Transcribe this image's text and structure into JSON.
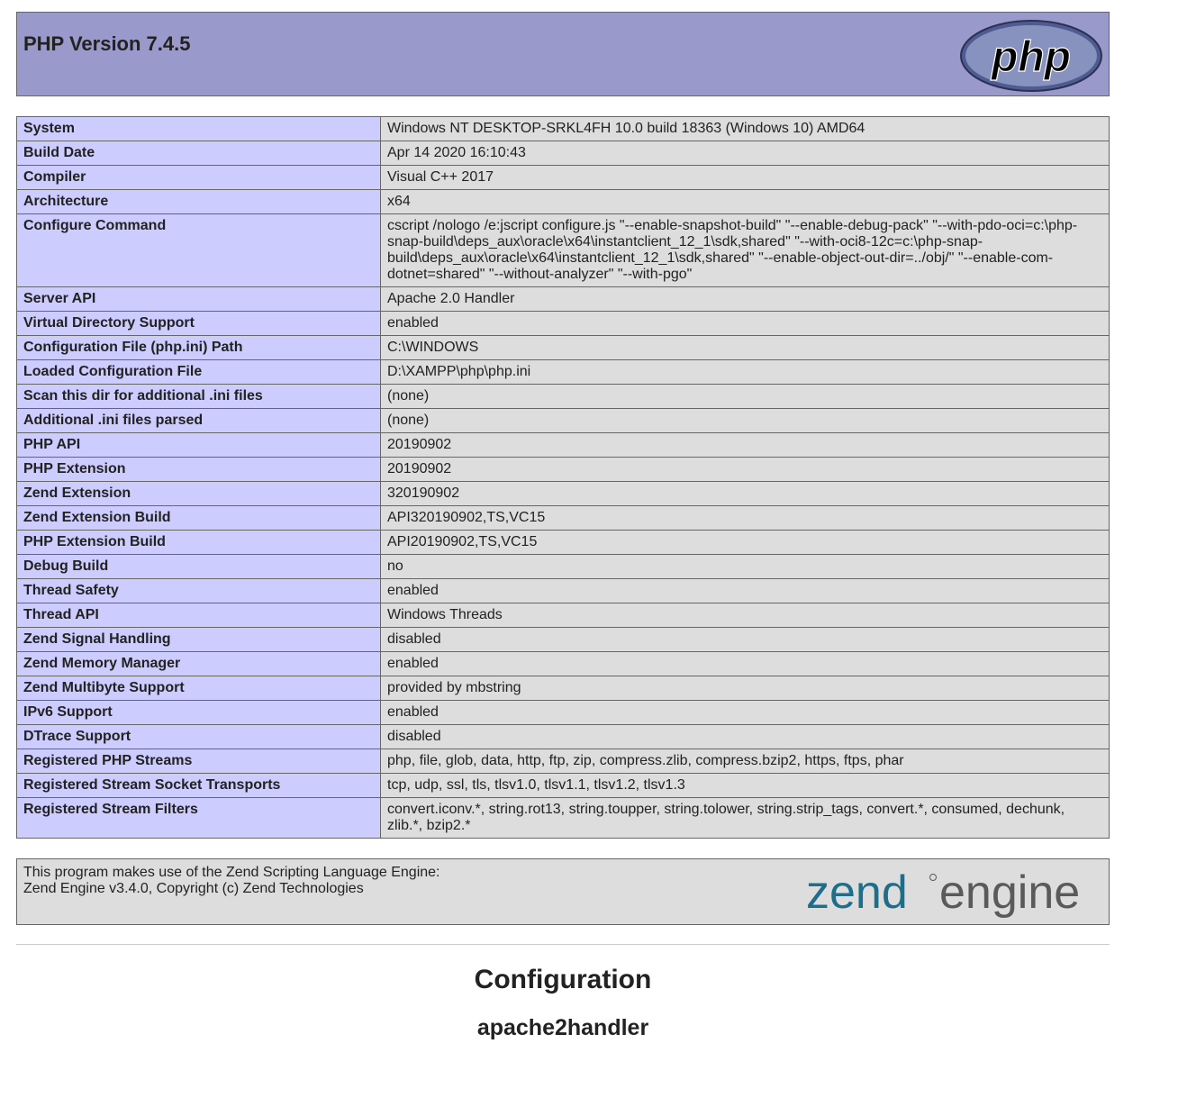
{
  "header": {
    "title": "PHP Version 7.4.5",
    "logo_text": "php"
  },
  "info_rows": [
    {
      "key": "System",
      "value": "Windows NT DESKTOP-SRKL4FH 10.0 build 18363 (Windows 10) AMD64"
    },
    {
      "key": "Build Date",
      "value": "Apr 14 2020 16:10:43"
    },
    {
      "key": "Compiler",
      "value": "Visual C++ 2017"
    },
    {
      "key": "Architecture",
      "value": "x64"
    },
    {
      "key": "Configure Command",
      "value": "cscript /nologo /e:jscript configure.js \"--enable-snapshot-build\" \"--enable-debug-pack\" \"--with-pdo-oci=c:\\php-snap-build\\deps_aux\\oracle\\x64\\instantclient_12_1\\sdk,shared\" \"--with-oci8-12c=c:\\php-snap-build\\deps_aux\\oracle\\x64\\instantclient_12_1\\sdk,shared\" \"--enable-object-out-dir=../obj/\" \"--enable-com-dotnet=shared\" \"--without-analyzer\" \"--with-pgo\""
    },
    {
      "key": "Server API",
      "value": "Apache 2.0 Handler"
    },
    {
      "key": "Virtual Directory Support",
      "value": "enabled"
    },
    {
      "key": "Configuration File (php.ini) Path",
      "value": "C:\\WINDOWS"
    },
    {
      "key": "Loaded Configuration File",
      "value": "D:\\XAMPP\\php\\php.ini"
    },
    {
      "key": "Scan this dir for additional .ini files",
      "value": "(none)"
    },
    {
      "key": "Additional .ini files parsed",
      "value": "(none)"
    },
    {
      "key": "PHP API",
      "value": "20190902"
    },
    {
      "key": "PHP Extension",
      "value": "20190902"
    },
    {
      "key": "Zend Extension",
      "value": "320190902"
    },
    {
      "key": "Zend Extension Build",
      "value": "API320190902,TS,VC15"
    },
    {
      "key": "PHP Extension Build",
      "value": "API20190902,TS,VC15"
    },
    {
      "key": "Debug Build",
      "value": "no"
    },
    {
      "key": "Thread Safety",
      "value": "enabled"
    },
    {
      "key": "Thread API",
      "value": "Windows Threads"
    },
    {
      "key": "Zend Signal Handling",
      "value": "disabled"
    },
    {
      "key": "Zend Memory Manager",
      "value": "enabled"
    },
    {
      "key": "Zend Multibyte Support",
      "value": "provided by mbstring"
    },
    {
      "key": "IPv6 Support",
      "value": "enabled"
    },
    {
      "key": "DTrace Support",
      "value": "disabled"
    },
    {
      "key": "Registered PHP Streams",
      "value": "php, file, glob, data, http, ftp, zip, compress.zlib, compress.bzip2, https, ftps, phar"
    },
    {
      "key": "Registered Stream Socket Transports",
      "value": "tcp, udp, ssl, tls, tlsv1.0, tlsv1.1, tlsv1.2, tlsv1.3"
    },
    {
      "key": "Registered Stream Filters",
      "value": "convert.iconv.*, string.rot13, string.toupper, string.tolower, string.strip_tags, convert.*, consumed, dechunk, zlib.*, bzip2.*"
    }
  ],
  "zend": {
    "line1": "This program makes use of the Zend Scripting Language Engine:",
    "line2": "Zend Engine v3.4.0, Copyright (c) Zend Technologies",
    "logo_word1": "zend",
    "logo_word2": "engine"
  },
  "sections": {
    "configuration": "Configuration",
    "module": "apache2handler"
  },
  "colors": {
    "header_bg": "#9999cc",
    "key_bg": "#ccccff",
    "value_bg": "#dddddd",
    "border": "#666666",
    "zend_blue": "#1e6d8a",
    "zend_gray": "#5a5a5a"
  }
}
